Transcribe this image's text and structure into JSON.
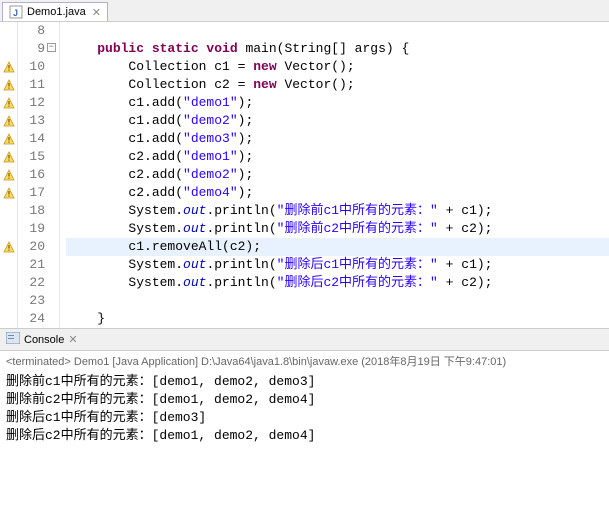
{
  "tab": {
    "label": "Demo1.java"
  },
  "code": {
    "lines": [
      {
        "n": 8,
        "marker": "",
        "html": ""
      },
      {
        "n": 9,
        "marker": "fold",
        "html": "    <span class='kw'>public static void</span> main(String[] args) {"
      },
      {
        "n": 10,
        "marker": "warn",
        "html": "        Collection c1 = <span class='kw'>new</span> Vector();"
      },
      {
        "n": 11,
        "marker": "warn",
        "html": "        Collection c2 = <span class='kw'>new</span> Vector();"
      },
      {
        "n": 12,
        "marker": "warn",
        "html": "        c1.add(<span class='str'>\"demo1\"</span>);"
      },
      {
        "n": 13,
        "marker": "warn",
        "html": "        c1.add(<span class='str'>\"demo2\"</span>);"
      },
      {
        "n": 14,
        "marker": "warn",
        "html": "        c1.add(<span class='str'>\"demo3\"</span>);"
      },
      {
        "n": 15,
        "marker": "warn",
        "html": "        c2.add(<span class='str'>\"demo1\"</span>);"
      },
      {
        "n": 16,
        "marker": "warn",
        "html": "        c2.add(<span class='str'>\"demo2\"</span>);"
      },
      {
        "n": 17,
        "marker": "warn",
        "html": "        c2.add(<span class='str'>\"demo4\"</span>);"
      },
      {
        "n": 18,
        "marker": "",
        "html": "        System.<span class='out'>out</span>.println(<span class='str'>\"删除前c1中所有的元素：\"</span> + c1);"
      },
      {
        "n": 19,
        "marker": "",
        "html": "        System.<span class='out'>out</span>.println(<span class='str'>\"删除前c2中所有的元素：\"</span> + c2);"
      },
      {
        "n": 20,
        "marker": "warn",
        "html": "        c1.removeAll(c2);",
        "hl": true
      },
      {
        "n": 21,
        "marker": "",
        "html": "        System.<span class='out'>out</span>.println(<span class='str'>\"删除后c1中所有的元素：\"</span> + c1);"
      },
      {
        "n": 22,
        "marker": "",
        "html": "        System.<span class='out'>out</span>.println(<span class='str'>\"删除后c2中所有的元素：\"</span> + c2);"
      },
      {
        "n": 23,
        "marker": "",
        "html": ""
      },
      {
        "n": 24,
        "marker": "",
        "html": "    }"
      }
    ]
  },
  "console": {
    "title": "Console",
    "terminated": "<terminated> Demo1 [Java Application] D:\\Java64\\java1.8\\bin\\javaw.exe (2018年8月19日 下午9:47:01)",
    "output": [
      "删除前c1中所有的元素：[demo1, demo2, demo3]",
      "删除前c2中所有的元素：[demo1, demo2, demo4]",
      "删除后c1中所有的元素：[demo3]",
      "删除后c2中所有的元素：[demo1, demo2, demo4]"
    ]
  }
}
